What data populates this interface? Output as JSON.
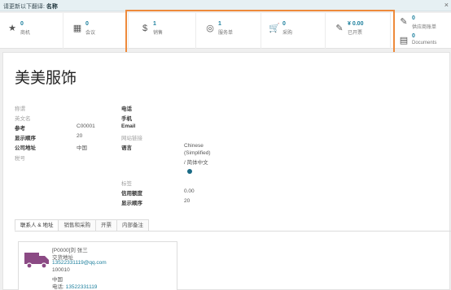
{
  "topbar": {
    "prefix": "请更新以下翻译:",
    "field": "名称",
    "close": "×"
  },
  "stats": [
    {
      "icon": "star-icon",
      "glyph": "★",
      "value": "0",
      "label": "商机"
    },
    {
      "icon": "calendar-icon",
      "glyph": "▦",
      "value": "0",
      "label": "会议"
    },
    {
      "icon": "dollar-icon",
      "glyph": "$",
      "value": "1",
      "label": "销售"
    },
    {
      "icon": "lifebuoy-icon",
      "glyph": "◎",
      "value": "1",
      "label": "服务单"
    },
    {
      "icon": "cart-icon",
      "glyph": "🛒",
      "value": "0",
      "label": "采购"
    },
    {
      "icon": "edit-icon",
      "glyph": "✎",
      "value": "¥ 0.00",
      "label": "已开票"
    },
    {
      "icon": "edit-icon",
      "glyph": "✎",
      "value": "0",
      "label": "供应商账单"
    },
    {
      "icon": "document-icon",
      "glyph": "▤",
      "value": "0",
      "label": "Documents"
    }
  ],
  "partner": {
    "name": "美美服饰",
    "left": {
      "title_label": "称谓",
      "english_label": "英文名",
      "ref_label": "参考",
      "ref_value": "C00001",
      "seq_label": "显示顺序",
      "seq_value": "20",
      "country_label": "公司地址",
      "country_value": "中国",
      "tax_label": "税号"
    },
    "right": {
      "phone_label": "电话",
      "mobile_label": "手机",
      "email_label": "Email",
      "website_label": "网站链接",
      "lang_label": "语言",
      "lang_value_1": "Chinese",
      "lang_value_2": "(Simplified)",
      "lang_value_3": "/ 简体中文",
      "tags_label": "标签",
      "credit_label": "信用额度",
      "credit_value": "0.00",
      "seq_label": "显示顺序",
      "seq_value": "20"
    }
  },
  "tabs": [
    "联系人 & 地址",
    "销售和采购",
    "开票",
    "内部备注"
  ],
  "contact_card": {
    "name": "[P0000]刘 张三",
    "type": "交货地址",
    "email": "13522331119@qq.com",
    "zip": "100010",
    "country": "中国",
    "phone_label": "电话:",
    "phone": "13522331119"
  },
  "colors": {
    "accent": "#1a7e9c",
    "highlight": "#ee8a3b",
    "truck": "#8b4a84"
  }
}
